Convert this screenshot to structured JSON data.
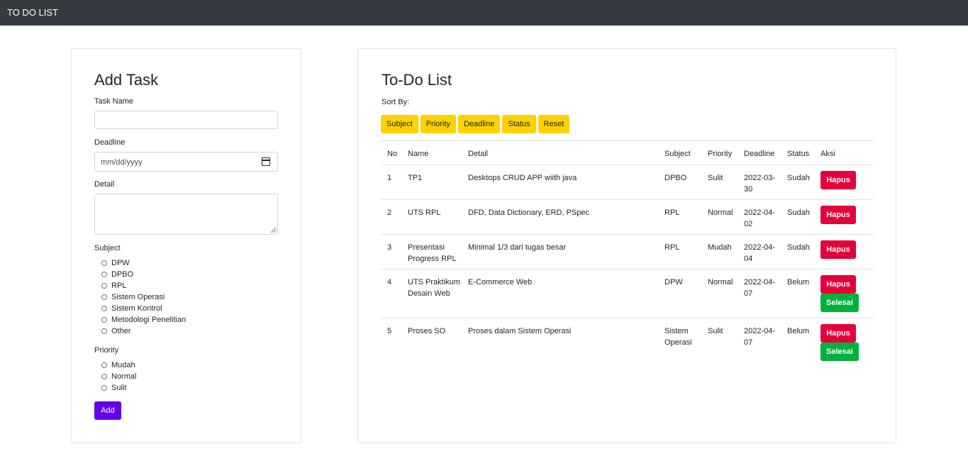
{
  "navbar": {
    "brand": "TO DO LIST"
  },
  "add_task": {
    "title": "Add Task",
    "task_name_label": "Task Name",
    "task_name_value": "",
    "deadline_label": "Deadline",
    "deadline_placeholder": "mm/dd/yyyy",
    "detail_label": "Detail",
    "detail_value": "",
    "subject_label": "Subject",
    "subjects": [
      "DPW",
      "DPBO",
      "RPL",
      "Sistem Operasi",
      "Sistem Kontrol",
      "Metodologi Penelitian",
      "Other"
    ],
    "priority_label": "Priority",
    "priorities": [
      "Mudah",
      "Normal",
      "Sulit"
    ],
    "add_button": "Add"
  },
  "todo": {
    "title": "To-Do List",
    "sort_label": "Sort By:",
    "sort_buttons": [
      "Subject",
      "Priority",
      "Deadline",
      "Status",
      "Reset"
    ],
    "columns": [
      "No",
      "Name",
      "Detail",
      "Subject",
      "Priority",
      "Deadline",
      "Status",
      "Aksi"
    ],
    "delete_label": "Hapus",
    "done_label": "Selesai",
    "rows": [
      {
        "no": "1",
        "name": "TP1",
        "detail": "Desktops CRUD APP wiith java",
        "subject": "DPBO",
        "priority": "Sulit",
        "deadline": "2022-03-30",
        "status": "Sudah",
        "show_done": false
      },
      {
        "no": "2",
        "name": "UTS RPL",
        "detail": "DFD, Data Dictionary, ERD, PSpec",
        "subject": "RPL",
        "priority": "Normal",
        "deadline": "2022-04-02",
        "status": "Sudah",
        "show_done": false
      },
      {
        "no": "3",
        "name": "Presentasi Progress RPL",
        "detail": "Minimal 1/3 dari tugas besar",
        "subject": "RPL",
        "priority": "Mudah",
        "deadline": "2022-04-04",
        "status": "Sudah",
        "show_done": false
      },
      {
        "no": "4",
        "name": "UTS Praktikum Desain Web",
        "detail": "E-Commerce Web",
        "subject": "DPW",
        "priority": "Normal",
        "deadline": "2022-04-07",
        "status": "Belum",
        "show_done": true
      },
      {
        "no": "5",
        "name": "Proses SO",
        "detail": "Proses dalam Sistem Operasi",
        "subject": "Sistem Operasi",
        "priority": "Sulit",
        "deadline": "2022-04-07",
        "status": "Belum",
        "show_done": true
      }
    ]
  }
}
